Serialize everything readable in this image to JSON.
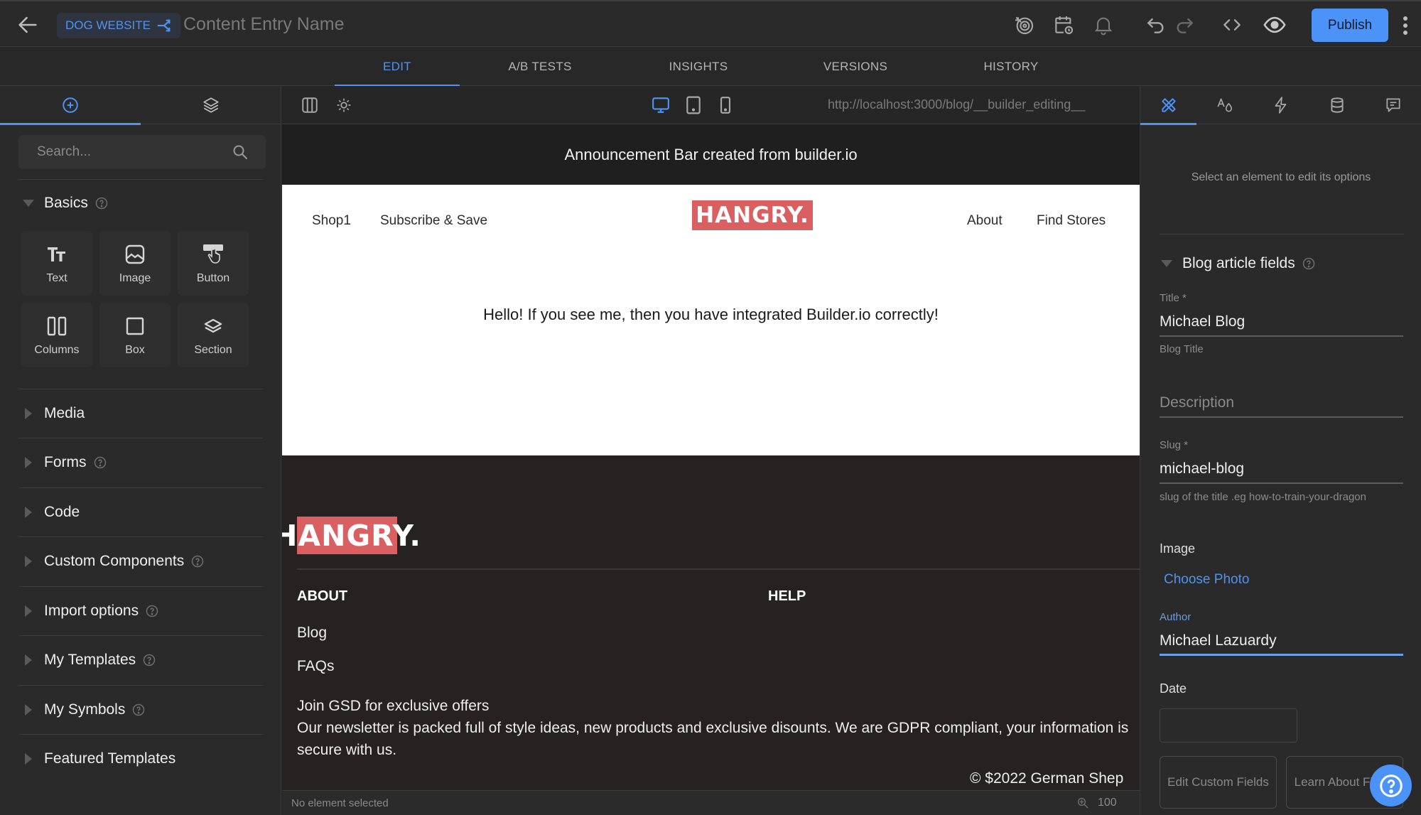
{
  "header": {
    "space_name": "DOG WEBSITE",
    "entry_name_placeholder": "Content Entry Name",
    "publish_label": "Publish"
  },
  "main_tabs": [
    {
      "label": "EDIT",
      "active": true
    },
    {
      "label": "A/B TESTS",
      "active": false
    },
    {
      "label": "INSIGHTS",
      "active": false
    },
    {
      "label": "VERSIONS",
      "active": false
    },
    {
      "label": "HISTORY",
      "active": false
    }
  ],
  "left_panel": {
    "search_placeholder": "Search...",
    "basics": {
      "label": "Basics",
      "blocks": [
        {
          "label": "Text",
          "icon": "text-icon"
        },
        {
          "label": "Image",
          "icon": "image-icon"
        },
        {
          "label": "Button",
          "icon": "button-icon"
        },
        {
          "label": "Columns",
          "icon": "columns-icon"
        },
        {
          "label": "Box",
          "icon": "box-icon"
        },
        {
          "label": "Section",
          "icon": "section-icon"
        }
      ]
    },
    "sections": [
      {
        "label": "Media",
        "help": false
      },
      {
        "label": "Forms",
        "help": true
      },
      {
        "label": "Code",
        "help": false
      },
      {
        "label": "Custom Components",
        "help": true
      },
      {
        "label": "Import options",
        "help": true
      },
      {
        "label": "My Templates",
        "help": true
      },
      {
        "label": "My Symbols",
        "help": true
      },
      {
        "label": "Featured Templates",
        "help": false
      }
    ]
  },
  "canvas": {
    "preview_url": "http://localhost:3000/blog/__builder_editing__",
    "announcement": "Announcement Bar created from builder.io",
    "nav_left": [
      "Shop1",
      "Subscribe & Save"
    ],
    "nav_right": [
      "About",
      "Find Stores"
    ],
    "logo_text": "HANGRY.",
    "hero_text": "Hello! If you see me, then you have integrated Builder.io correctly!",
    "footer": {
      "logo_text": "HANGRY.",
      "col_about": "ABOUT",
      "col_help": "HELP",
      "links": [
        "Blog",
        "FAQs"
      ],
      "newsletter_title": "Join GSD for exclusive offers",
      "newsletter_body": "Our newsletter is packed full of style ideas, new products and exclusive disounts. We are GDPR compliant, your information is secure with us.",
      "copyright": "© $2022 German Shep"
    },
    "status_text": "No element selected",
    "zoom_level": "100"
  },
  "right_panel": {
    "hint": "Select an element to edit its options",
    "section_label": "Blog article fields",
    "fields": {
      "title_label": "Title *",
      "title_value": "Michael Blog",
      "title_help": "Blog Title",
      "description_placeholder": "Description",
      "slug_label": "Slug *",
      "slug_value": "michael-blog",
      "slug_help": "slug of the title .eg how-to-train-your-dragon",
      "image_label": "Image",
      "choose_photo": "Choose Photo",
      "author_label": "Author",
      "author_value": "Michael Lazuardy",
      "date_label": "Date",
      "date_value": ""
    },
    "buttons": {
      "edit_custom_fields": "Edit Custom Fields",
      "learn_about_fields": "Learn About Fields"
    }
  },
  "colors": {
    "accent": "#4c93f7",
    "logo_bg": "#d95f61",
    "footer_bg": "#252221"
  }
}
